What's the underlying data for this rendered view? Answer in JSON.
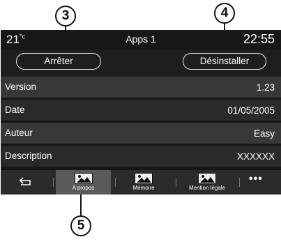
{
  "callouts": {
    "stop": "3",
    "uninstall": "4",
    "about": "5"
  },
  "status_bar": {
    "temperature": "21",
    "temperature_unit": "°c",
    "title": "Apps 1",
    "time": "22:55"
  },
  "actions": {
    "stop_label": "Arrêter",
    "uninstall_label": "Désinstaller"
  },
  "details": [
    {
      "label": "Version",
      "value": "1.23"
    },
    {
      "label": "Date",
      "value": "01/05/2005"
    },
    {
      "label": "Auteur",
      "value": "Easy"
    },
    {
      "label": "Description",
      "value": "XXXXXX"
    }
  ],
  "tabs": [
    {
      "label": "A propos",
      "icon": "image-icon",
      "active": true
    },
    {
      "label": "Mémoire",
      "icon": "image-icon",
      "active": false
    },
    {
      "label": "Mention légale",
      "icon": "image-icon",
      "active": false
    }
  ],
  "more_label": "•••",
  "colors": {
    "screen_bg": "#161616",
    "row_light": "#383838",
    "row_dark": "#2a2a2a",
    "active_tab": "#5a5a5a"
  }
}
